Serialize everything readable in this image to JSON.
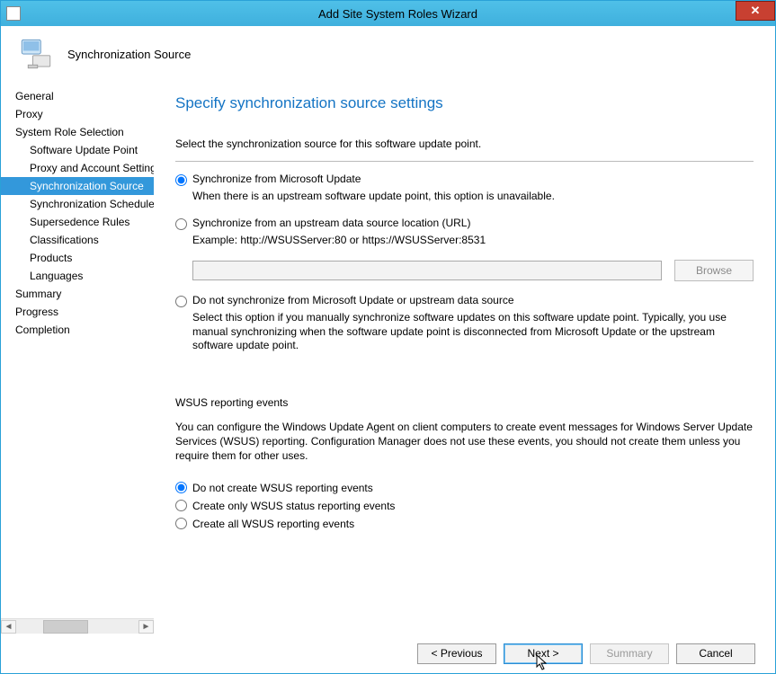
{
  "window": {
    "title": "Add Site System Roles Wizard"
  },
  "header": {
    "title": "Synchronization Source"
  },
  "sidebar": {
    "items": [
      {
        "label": "General",
        "sub": false,
        "selected": false
      },
      {
        "label": "Proxy",
        "sub": false,
        "selected": false
      },
      {
        "label": "System Role Selection",
        "sub": false,
        "selected": false
      },
      {
        "label": "Software Update Point",
        "sub": true,
        "selected": false
      },
      {
        "label": "Proxy and Account Settings",
        "sub": true,
        "selected": false
      },
      {
        "label": "Synchronization Source",
        "sub": true,
        "selected": true
      },
      {
        "label": "Synchronization Schedule",
        "sub": true,
        "selected": false
      },
      {
        "label": "Supersedence Rules",
        "sub": true,
        "selected": false
      },
      {
        "label": "Classifications",
        "sub": true,
        "selected": false
      },
      {
        "label": "Products",
        "sub": true,
        "selected": false
      },
      {
        "label": "Languages",
        "sub": true,
        "selected": false
      },
      {
        "label": "Summary",
        "sub": false,
        "selected": false
      },
      {
        "label": "Progress",
        "sub": false,
        "selected": false
      },
      {
        "label": "Completion",
        "sub": false,
        "selected": false
      }
    ]
  },
  "content": {
    "page_title": "Specify synchronization source settings",
    "intro": "Select the synchronization source for this software update point.",
    "sync_options": {
      "opt1_label": "Synchronize from Microsoft Update",
      "opt1_desc": "When there is an upstream software update point, this option is unavailable.",
      "opt2_label": "Synchronize from an upstream data source location (URL)",
      "opt2_desc": "Example: http://WSUSServer:80 or https://WSUSServer:8531",
      "url_value": "",
      "browse_label": "Browse",
      "opt3_label": "Do not synchronize from Microsoft Update or upstream data source",
      "opt3_desc": "Select this option if you manually synchronize software updates on this software update point. Typically, you use manual synchronizing when the software update point is disconnected from Microsoft Update or the upstream software update point.",
      "selected": "opt1"
    },
    "wsus": {
      "title": "WSUS reporting events",
      "desc": "You can configure the Windows Update Agent on client computers to create event messages for Windows Server Update Services (WSUS) reporting. Configuration Manager does not use these events, you should not create them unless you require them for other uses.",
      "r1": "Do not create WSUS reporting events",
      "r2": "Create only WSUS status reporting events",
      "r3": "Create all WSUS reporting events",
      "selected": "r1"
    }
  },
  "footer": {
    "previous": "< Previous",
    "next": "Next >",
    "summary": "Summary",
    "cancel": "Cancel"
  }
}
